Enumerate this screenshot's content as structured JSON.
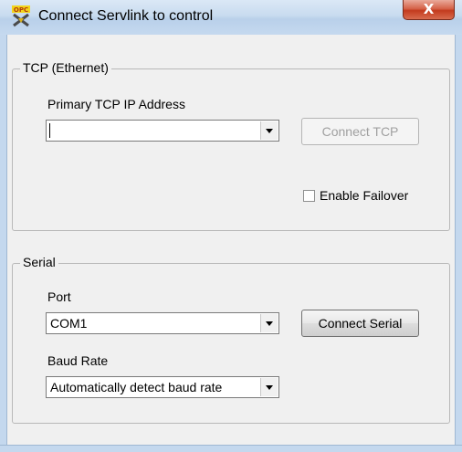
{
  "window": {
    "title": "Connect Servlink to control",
    "close_glyph": "X",
    "icon": "opc-app-icon"
  },
  "tcp": {
    "group_label": "TCP (Ethernet)",
    "ip_label": "Primary TCP IP Address",
    "ip_value": "",
    "connect_button": "Connect TCP",
    "failover_label": "Enable Failover",
    "failover_checked": false
  },
  "serial": {
    "group_label": "Serial",
    "port_label": "Port",
    "port_value": "COM1",
    "connect_button": "Connect Serial",
    "baud_label": "Baud Rate",
    "baud_value": "Automatically detect baud rate"
  }
}
